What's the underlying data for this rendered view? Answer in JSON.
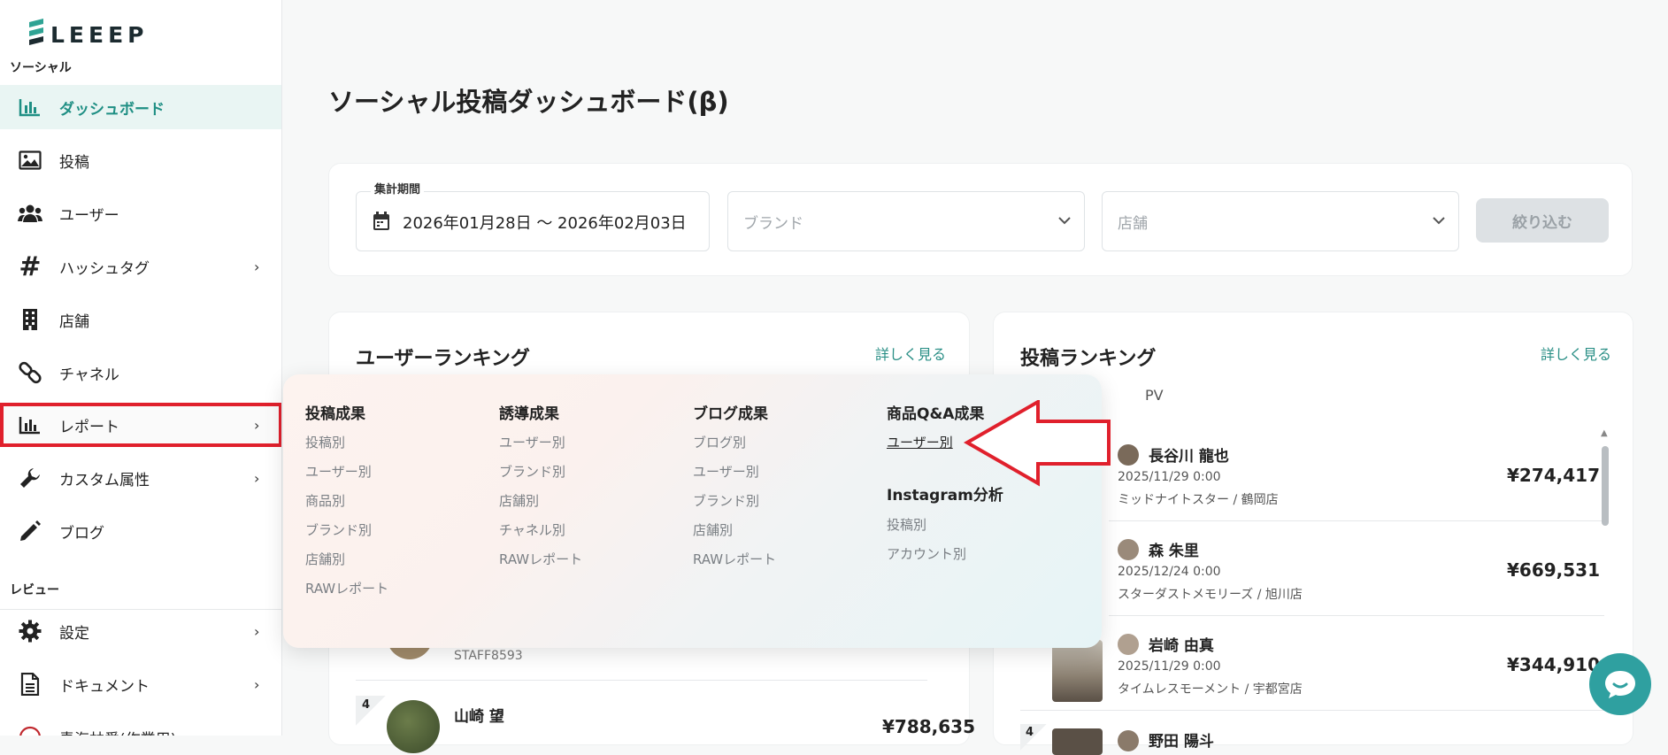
{
  "sidebar": {
    "logo_text": "LEEEP",
    "section_social": "ソーシャル",
    "section_review": "レビュー",
    "items": [
      {
        "label": "ダッシュボード",
        "icon": "bar-chart-icon"
      },
      {
        "label": "投稿",
        "icon": "image-icon"
      },
      {
        "label": "ユーザー",
        "icon": "users-icon"
      },
      {
        "label": "ハッシュタグ",
        "icon": "hash-icon"
      },
      {
        "label": "店舗",
        "icon": "building-icon"
      },
      {
        "label": "チャネル",
        "icon": "link-icon"
      },
      {
        "label": "レポート",
        "icon": "bar-chart-icon"
      },
      {
        "label": "カスタム属性",
        "icon": "wrench-icon"
      },
      {
        "label": "ブログ",
        "icon": "pencil-icon"
      }
    ],
    "review_items": [
      {
        "label": "設定",
        "icon": "gear-icon"
      },
      {
        "label": "ドキュメント",
        "icon": "document-icon"
      },
      {
        "label": "青海林愛(作業用)",
        "icon": "user-badge-icon"
      }
    ]
  },
  "page": {
    "title": "ソーシャル投稿ダッシュボード(β)"
  },
  "filters": {
    "period_label": "集計期間",
    "period_value": "2026年01月28日 〜 2026年02月03日",
    "brand_placeholder": "ブランド",
    "store_placeholder": "店舗",
    "submit_label": "絞り込む"
  },
  "user_ranking": {
    "title": "ユーザーランキング",
    "more": "詳しく見る",
    "partial_row_sub": "STAFF8593",
    "rank4_num": "4",
    "rank4_name": "山崎 望",
    "rank4_value": "¥788,635"
  },
  "post_ranking": {
    "title": "投稿ランキング",
    "more": "詳しく見る",
    "col_pv": "PV",
    "rows": [
      {
        "name": "長谷川 龍也",
        "date": "2025/11/29 0:00",
        "shop": "ミッドナイトスター / 鶴岡店",
        "value": "¥274,417"
      },
      {
        "name": "森 朱里",
        "date": "2025/12/24 0:00",
        "shop": "スターダストメモリーズ / 旭川店",
        "value": "¥669,531"
      },
      {
        "name": "岩崎 由真",
        "date": "2025/11/29 0:00",
        "shop": "タイムレスモーメント / 宇都宮店",
        "value": "¥344,910"
      }
    ],
    "rank4_num": "4",
    "rank4_name": "野田 陽斗"
  },
  "report_menu": {
    "col1": {
      "heading": "投稿成果",
      "links": [
        "投稿別",
        "ユーザー別",
        "商品別",
        "ブランド別",
        "店舗別",
        "RAWレポート"
      ]
    },
    "col2": {
      "heading": "誘導成果",
      "links": [
        "ユーザー別",
        "ブランド別",
        "店舗別",
        "チャネル別",
        "RAWレポート"
      ]
    },
    "col3": {
      "heading": "ブログ成果",
      "links": [
        "ブログ別",
        "ユーザー別",
        "ブランド別",
        "店舗別",
        "RAWレポート"
      ]
    },
    "col4": {
      "heading": "商品Q&A成果",
      "links": [
        "ユーザー別"
      ]
    },
    "col5": {
      "heading": "Instagram分析",
      "links": [
        "投稿別",
        "アカウント別"
      ]
    }
  },
  "colors": {
    "accent": "#1f8f84",
    "highlight": "#e0202c",
    "chat": "#2fa0a0"
  }
}
